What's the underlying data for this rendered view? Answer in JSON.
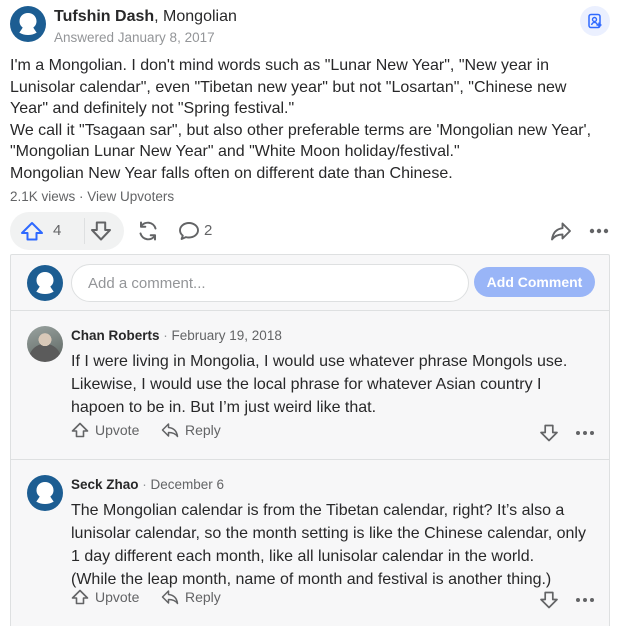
{
  "author": {
    "name": "Tufshin Dash",
    "credential": ", Mongolian",
    "answered": "Answered January 8, 2017"
  },
  "answer": {
    "lines": [
      "I'm a Mongolian. I don't mind words such as \"Lunar New Year\", \"New year in",
      "Lunisolar calendar\", even \"Tibetan new year\" but not \"Losartan\", \"Chinese new",
      "Year\" and definitely not \"Spring festival.\"",
      "We call it \"Tsagaan sar\", but also other preferable terms are 'Mongolian new Year',",
      "\"Mongolian Lunar New Year\" and \"White Moon holiday/festival.\"",
      "Mongolian New Year falls often on different date than Chinese."
    ]
  },
  "stats": {
    "views": "2.1K views",
    "separator": " · ",
    "upvoters_link": "View Upvoters"
  },
  "actions": {
    "upvote_count": "4",
    "comment_count": "2"
  },
  "add_comment": {
    "placeholder": "Add a comment...",
    "button_label": "Add Comment"
  },
  "comments": [
    {
      "name": "Chan Roberts",
      "separator": " · ",
      "date": "February 19, 2018",
      "lines": [
        "If I were living in Mongolia, I would use whatever phrase Mongols use.",
        "Likewise, I would use the local phrase for whatever Asian country I",
        "hapoen to be in. But I’m just weird like that."
      ],
      "upvote_label": "Upvote",
      "reply_label": "Reply"
    },
    {
      "name": "Seck Zhao",
      "separator": " · ",
      "date": "December 6",
      "lines": [
        "The Mongolian calendar is from the Tibetan calendar, right? It’s also a",
        "lunisolar calendar, so the month setting is like the Chinese calendar, only",
        "1 day different each month, like all lunisolar calendar in the world.",
        "(While the leap month, name of month and festival is another thing.)"
      ],
      "upvote_label": "Upvote",
      "reply_label": "Reply"
    }
  ],
  "colors": {
    "accent": "#2e69ff",
    "button_disabled": "#99b5f7",
    "default_avatar": "#1c5d92",
    "muted_text": "#636466"
  }
}
